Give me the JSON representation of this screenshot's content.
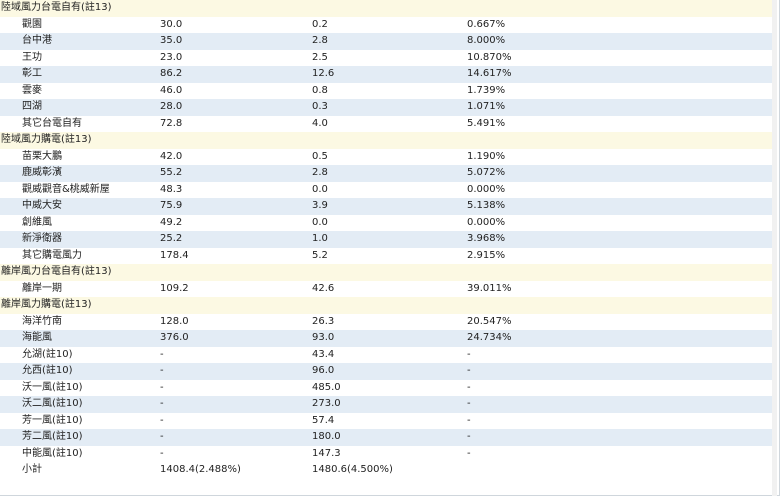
{
  "sections": [
    {
      "title": "陸域風力台電自有(註13)",
      "rows": [
        {
          "name": "觀園",
          "capacity": "30.0",
          "output": "0.2",
          "ratio": "0.667%"
        },
        {
          "name": "台中港",
          "capacity": "35.0",
          "output": "2.8",
          "ratio": "8.000%"
        },
        {
          "name": "王功",
          "capacity": "23.0",
          "output": "2.5",
          "ratio": "10.870%"
        },
        {
          "name": "彰工",
          "capacity": "86.2",
          "output": "12.6",
          "ratio": "14.617%"
        },
        {
          "name": "雲麥",
          "capacity": "46.0",
          "output": "0.8",
          "ratio": "1.739%"
        },
        {
          "name": "四湖",
          "capacity": "28.0",
          "output": "0.3",
          "ratio": "1.071%"
        },
        {
          "name": "其它台電自有",
          "capacity": "72.8",
          "output": "4.0",
          "ratio": "5.491%"
        }
      ]
    },
    {
      "title": "陸域風力購電(註13)",
      "rows": [
        {
          "name": "苗栗大鵬",
          "capacity": "42.0",
          "output": "0.5",
          "ratio": "1.190%"
        },
        {
          "name": "鹿威彰濱",
          "capacity": "55.2",
          "output": "2.8",
          "ratio": "5.072%"
        },
        {
          "name": "觀威觀音&桃威新屋",
          "capacity": "48.3",
          "output": "0.0",
          "ratio": "0.000%"
        },
        {
          "name": "中威大安",
          "capacity": "75.9",
          "output": "3.9",
          "ratio": "5.138%"
        },
        {
          "name": "創維風",
          "capacity": "49.2",
          "output": "0.0",
          "ratio": "0.000%"
        },
        {
          "name": "新淨衛器",
          "capacity": "25.2",
          "output": "1.0",
          "ratio": "3.968%"
        },
        {
          "name": "其它購電風力",
          "capacity": "178.4",
          "output": "5.2",
          "ratio": "2.915%"
        }
      ]
    },
    {
      "title": "離岸風力台電自有(註13)",
      "rows": [
        {
          "name": "離岸一期",
          "capacity": "109.2",
          "output": "42.6",
          "ratio": "39.011%"
        }
      ]
    },
    {
      "title": "離岸風力購電(註13)",
      "rows": [
        {
          "name": "海洋竹南",
          "capacity": "128.0",
          "output": "26.3",
          "ratio": "20.547%"
        },
        {
          "name": "海能風",
          "capacity": "376.0",
          "output": "93.0",
          "ratio": "24.734%"
        },
        {
          "name": "允湖(註10)",
          "capacity": "-",
          "output": "43.4",
          "ratio": "-"
        },
        {
          "name": "允西(註10)",
          "capacity": "-",
          "output": "96.0",
          "ratio": "-"
        },
        {
          "name": "沃一風(註10)",
          "capacity": "-",
          "output": "485.0",
          "ratio": "-"
        },
        {
          "name": "沃二風(註10)",
          "capacity": "-",
          "output": "273.0",
          "ratio": "-"
        },
        {
          "name": "芳一風(註10)",
          "capacity": "-",
          "output": "57.4",
          "ratio": "-"
        },
        {
          "name": "芳二風(註10)",
          "capacity": "-",
          "output": "180.0",
          "ratio": "-"
        },
        {
          "name": "中能風(註10)",
          "capacity": "-",
          "output": "147.3",
          "ratio": "-"
        }
      ]
    }
  ],
  "total": {
    "name": "小計",
    "capacity": "1408.4(2.488%)",
    "output": "1480.6(4.500%)",
    "ratio": ""
  }
}
